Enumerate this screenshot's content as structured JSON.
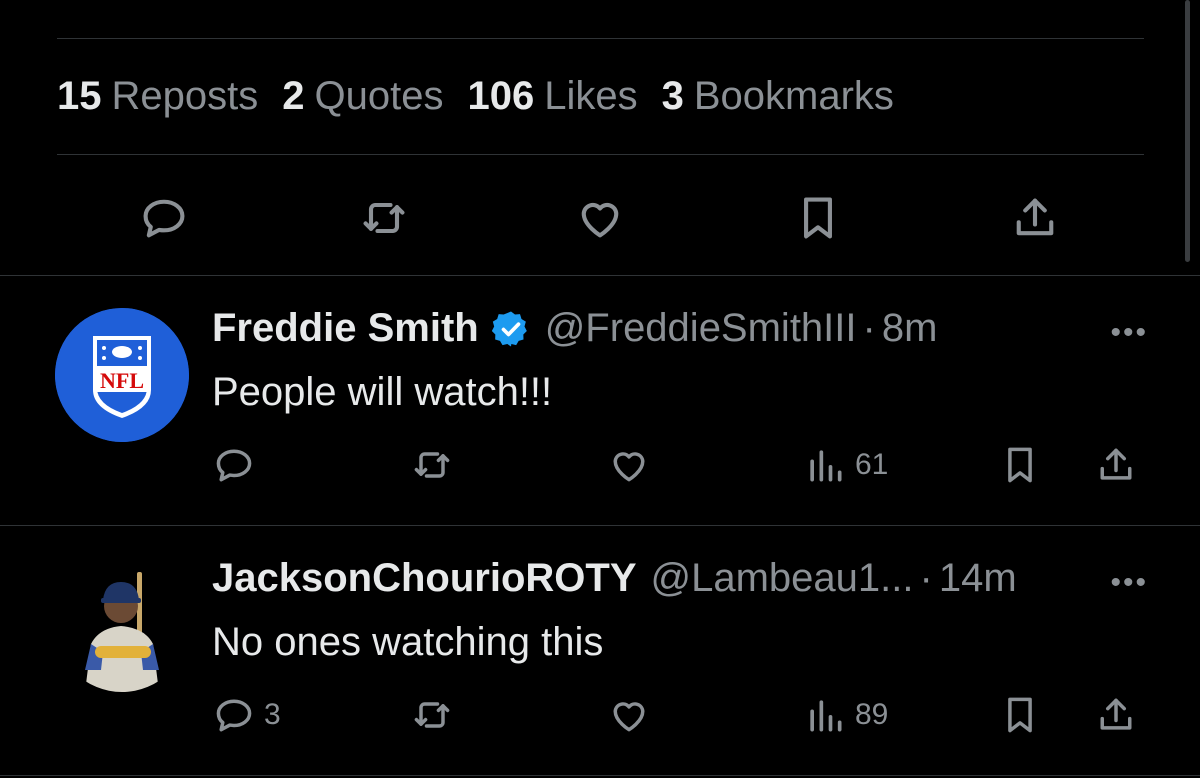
{
  "stats": {
    "reposts": {
      "count": "15",
      "label": "Reposts"
    },
    "quotes": {
      "count": "2",
      "label": "Quotes"
    },
    "likes": {
      "count": "106",
      "label": "Likes"
    },
    "bookmarks": {
      "count": "3",
      "label": "Bookmarks"
    }
  },
  "top_actions": [
    "reply-icon",
    "repost-icon",
    "like-icon",
    "bookmark-icon",
    "share-icon"
  ],
  "replies": [
    {
      "display_name": "Freddie Smith",
      "verified": true,
      "handle": "@FreddieSmithIII",
      "separator": "·",
      "time": "8m",
      "text": "People will watch!!!",
      "avatar": "nfl-logo",
      "reply_count": "",
      "views": "61"
    },
    {
      "display_name": "JacksonChourioROTY",
      "verified": false,
      "handle": "@Lambeau1...",
      "separator": "·",
      "time": "14m",
      "text": "No ones watching this",
      "avatar": "baseball-player-photo",
      "reply_count": "3",
      "views": "89"
    }
  ],
  "more_label": "•••",
  "colors": {
    "background": "#000000",
    "text": "#e7e9ea",
    "muted": "#8b9095",
    "divider": "#2f3336",
    "verified": "#1d9bf0",
    "nfl_blue": "#1f5fd8",
    "nfl_red": "#d50a0a"
  }
}
